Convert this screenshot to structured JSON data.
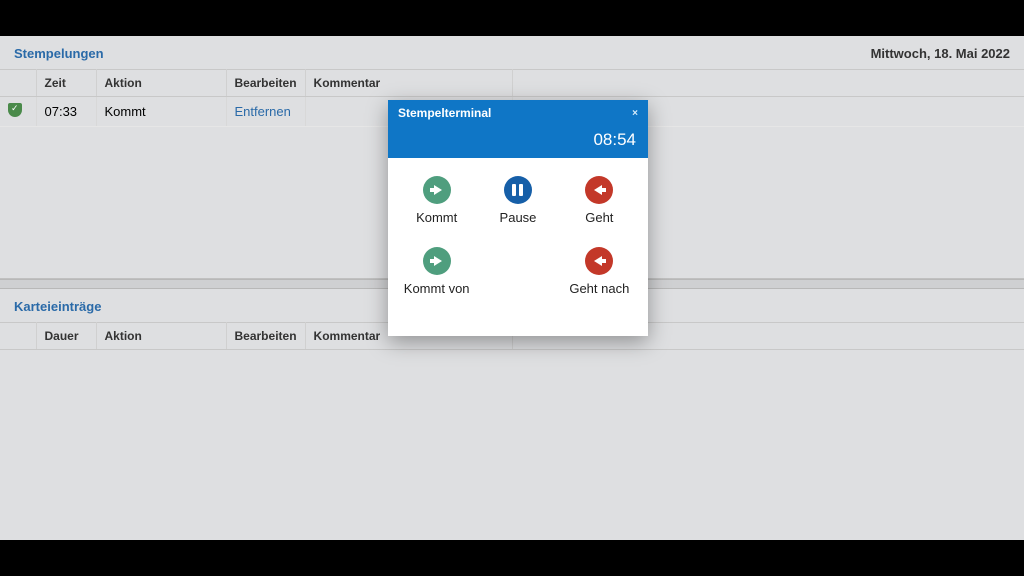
{
  "header": {
    "stempelungen_title": "Stempelungen",
    "date_text": "Mittwoch, 18. Mai 2022"
  },
  "stempelungen": {
    "columns": {
      "zeit": "Zeit",
      "aktion": "Aktion",
      "bearbeiten": "Bearbeiten",
      "kommentar": "Kommentar"
    },
    "rows": [
      {
        "zeit": "07:33",
        "aktion": "Kommt",
        "bearbeiten": "Entfernen",
        "kommentar": ""
      }
    ]
  },
  "karteieintraege": {
    "title": "Karteieinträge",
    "columns": {
      "dauer": "Dauer",
      "aktion": "Aktion",
      "bearbeiten": "Bearbeiten",
      "kommentar": "Kommentar"
    }
  },
  "modal": {
    "title": "Stempelterminal",
    "close": "×",
    "time": "08:54",
    "buttons": {
      "kommt": "Kommt",
      "pause": "Pause",
      "geht": "Geht",
      "kommt_von": "Kommt von",
      "geht_nach": "Geht nach"
    }
  }
}
